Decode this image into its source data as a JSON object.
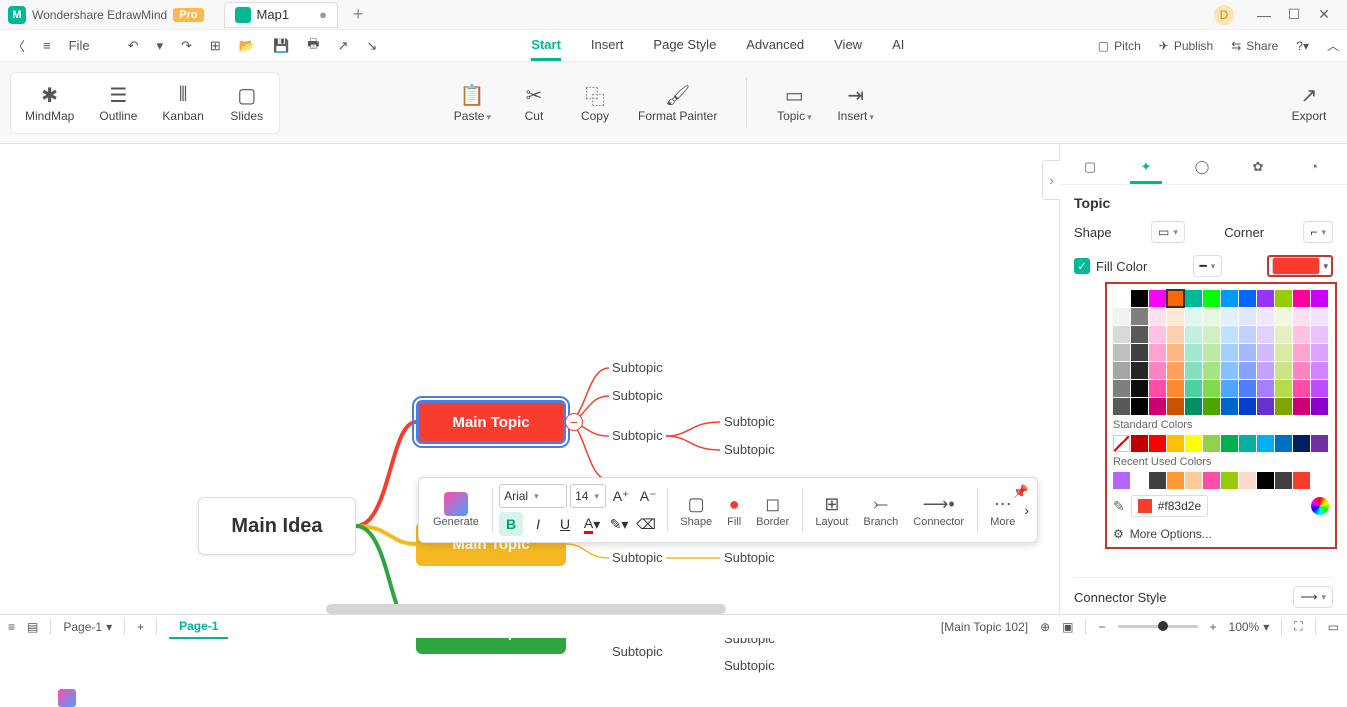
{
  "titlebar": {
    "app_name": "Wondershare EdrawMind",
    "pro_label": "Pro",
    "tab_name": "Map1",
    "user_initial": "D"
  },
  "qa": {
    "file_label": "File",
    "pitch": "Pitch",
    "publish": "Publish",
    "share": "Share"
  },
  "menus": [
    "Start",
    "Insert",
    "Page Style",
    "Advanced",
    "View",
    "AI"
  ],
  "ribbon": {
    "view_modes": [
      "MindMap",
      "Outline",
      "Kanban",
      "Slides"
    ],
    "actions": [
      "Paste",
      "Cut",
      "Copy",
      "Format Painter",
      "Topic",
      "Insert"
    ],
    "export": "Export"
  },
  "mindmap": {
    "root": "Main Idea",
    "topics": [
      "Main Topic",
      "Main Topic",
      "Main Topic"
    ],
    "subtopic_label": "Subtopic"
  },
  "float": {
    "generate": "Generate",
    "font": "Arial",
    "size": "14",
    "shape": "Shape",
    "fill": "Fill",
    "border": "Border",
    "layout": "Layout",
    "branch": "Branch",
    "connector": "Connector",
    "more": "More"
  },
  "panel": {
    "title": "Topic",
    "shape": "Shape",
    "corner": "Corner",
    "fill_color": "Fill Color",
    "connector_style": "Connector Style"
  },
  "color_picker": {
    "standard": "Standard Colors",
    "recent": "Recent Used Colors",
    "hex": "#f83d2e",
    "more": "More Options...",
    "theme_rows": [
      [
        "#ffffff",
        "#000000",
        "#ff00ff",
        "#ff6600",
        "#00b894",
        "#00ff00",
        "#0099ff",
        "#0066ff",
        "#9933ff",
        "#99cc00",
        "#ff0099",
        "#cc00ff"
      ],
      [
        "#f2f2f2",
        "#7f7f7f",
        "#ffe0f0",
        "#ffe8d6",
        "#e0f7ef",
        "#e8f7e0",
        "#e0f0ff",
        "#e0e8ff",
        "#f0e8ff",
        "#f2f7e0",
        "#ffe0f0",
        "#f4e0ff"
      ],
      [
        "#d9d9d9",
        "#595959",
        "#ffc2e0",
        "#ffd0ad",
        "#c2efdf",
        "#d1efc2",
        "#c2e0ff",
        "#c2d1ff",
        "#e0d1ff",
        "#e5efc2",
        "#ffc2e0",
        "#e9c2ff"
      ],
      [
        "#bfbfbf",
        "#404040",
        "#ffa3d1",
        "#ffb885",
        "#a3e7cf",
        "#baeaa3",
        "#a3d1ff",
        "#a3baff",
        "#d1baff",
        "#d8eaa3",
        "#ffa3d1",
        "#dea3ff"
      ],
      [
        "#a6a6a6",
        "#262626",
        "#ff85c2",
        "#ffa05c",
        "#85dfbf",
        "#a3e585",
        "#85c2ff",
        "#85a3ff",
        "#c2a3ff",
        "#cbe585",
        "#ff85c2",
        "#d385ff"
      ],
      [
        "#7f7f7f",
        "#0d0d0d",
        "#ff4da6",
        "#ff8833",
        "#4dd1a1",
        "#7fdb4d",
        "#4da6ff",
        "#4d7fff",
        "#a67fff",
        "#b2db4d",
        "#ff4da6",
        "#bf4dff"
      ],
      [
        "#595959",
        "#000000",
        "#cc0073",
        "#cc5200",
        "#008f60",
        "#4ca600",
        "#0066cc",
        "#0040cc",
        "#6633cc",
        "#7fa600",
        "#cc0073",
        "#8c00cc"
      ]
    ],
    "standard_row": [
      "#c00000",
      "#ff0000",
      "#ffc000",
      "#ffff00",
      "#92d050",
      "#00b050",
      "#00b0a0",
      "#00b0f0",
      "#0070c0",
      "#002060",
      "#7030a0"
    ],
    "recent_row": [
      "#b266ff",
      "#ffffff",
      "#404040",
      "#ff9933",
      "#ffcc99",
      "#ff4da6",
      "#99cc00",
      "#ffd9cc",
      "#000000",
      "#404040",
      "#f83d2e"
    ]
  },
  "status": {
    "page_select": "Page-1",
    "page_tab": "Page-1",
    "selection": "[Main Topic 102]",
    "zoom": "100%"
  },
  "chart_data": {
    "type": "mindmap",
    "root": "Main Idea",
    "children": [
      {
        "label": "Main Topic",
        "color": "#f83d2e",
        "selected": true,
        "children": [
          "Subtopic",
          "Subtopic",
          {
            "label": "Subtopic",
            "children": [
              "Subtopic",
              "Subtopic"
            ]
          },
          "Subtopic"
        ]
      },
      {
        "label": "Main Topic",
        "color": "#f5b820",
        "children": [
          {
            "label": "Subtopic",
            "children": [
              "Subtopic"
            ]
          }
        ]
      },
      {
        "label": "Main Topic",
        "color": "#2ea640",
        "children": [
          "Subtopic",
          {
            "label": "Subtopic",
            "children": [
              "Subtopic",
              "Subtopic"
            ]
          }
        ]
      }
    ]
  }
}
